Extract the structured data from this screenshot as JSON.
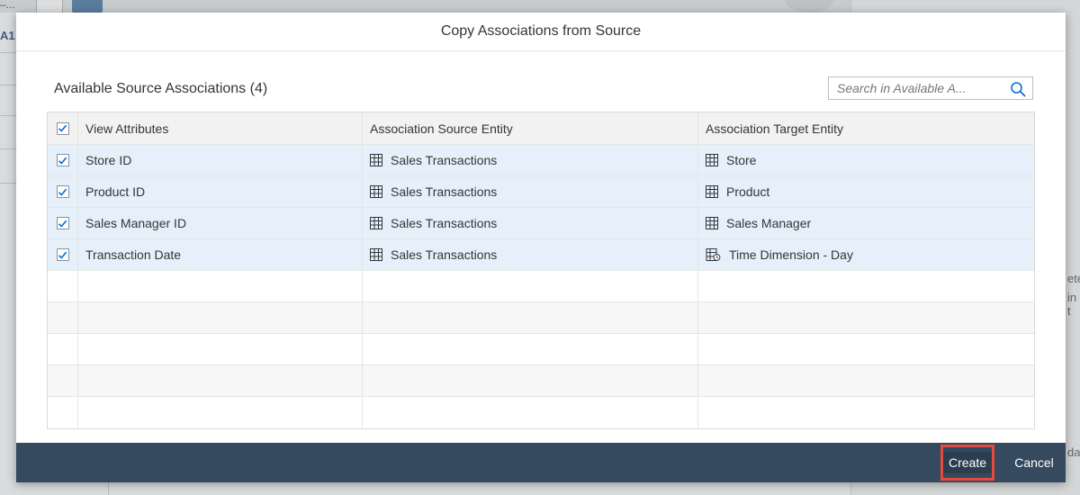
{
  "background": {
    "left_fragment_top": "–...",
    "left_fragment": "A1",
    "right_fragment_1": "ete",
    "right_fragment_2": "in t",
    "right_fragment_3": "dat"
  },
  "dialog": {
    "title": "Copy Associations from Source",
    "section_title": "Available Source Associations (4)",
    "search": {
      "placeholder": "Search in Available A..."
    },
    "table": {
      "columns": [
        "View Attributes",
        "Association Source Entity",
        "Association Target Entity"
      ],
      "header_checked": true,
      "rows": [
        {
          "checked": true,
          "attribute": "Store ID",
          "source": "Sales Transactions",
          "target": "Store",
          "target_icon": "table-icon"
        },
        {
          "checked": true,
          "attribute": "Product ID",
          "source": "Sales Transactions",
          "target": "Product",
          "target_icon": "table-icon"
        },
        {
          "checked": true,
          "attribute": "Sales Manager ID",
          "source": "Sales Transactions",
          "target": "Sales Manager",
          "target_icon": "table-icon"
        },
        {
          "checked": true,
          "attribute": "Transaction Date",
          "source": "Sales Transactions",
          "target": "Time Dimension - Day",
          "target_icon": "time-dimension-icon"
        }
      ],
      "empty_rows": 5
    },
    "footer": {
      "create_label": "Create",
      "cancel_label": "Cancel"
    }
  },
  "colors": {
    "footer_bg": "#354a5f",
    "selected_row_bg": "#e5f0fa",
    "highlight_border": "#e64a3b"
  }
}
